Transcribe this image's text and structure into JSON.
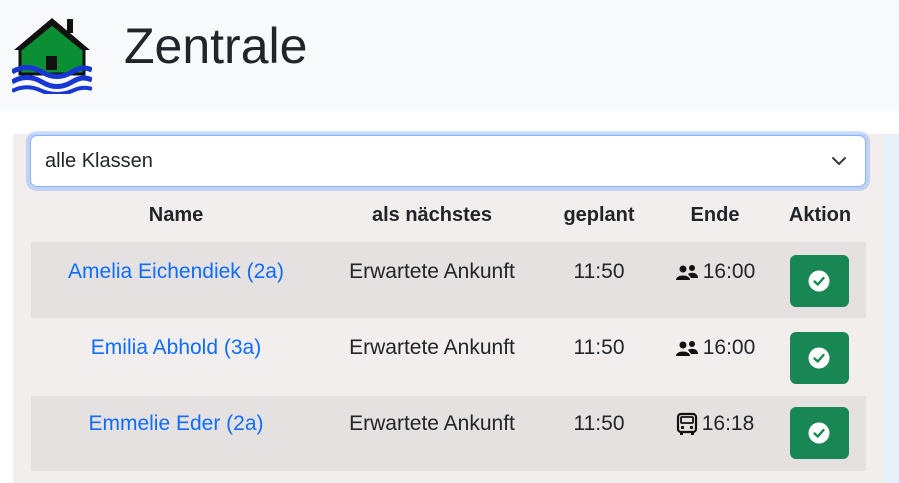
{
  "header": {
    "title": "Zentrale",
    "logo_icon": "house-flood-icon"
  },
  "filter": {
    "selected": "alle Klassen",
    "icon": "chevron-down-icon"
  },
  "table": {
    "columns": [
      "Name",
      "als nächstes",
      "geplant",
      "Ende",
      "Aktion"
    ],
    "rows": [
      {
        "name": "Amelia Eichendiek (2a)",
        "next": "Erwartete Ankunft",
        "planned": "11:50",
        "end_icon": "people-icon",
        "end": "16:00",
        "action_icon": "check-circle-icon"
      },
      {
        "name": "Emilia Abhold (3a)",
        "next": "Erwartete Ankunft",
        "planned": "11:50",
        "end_icon": "people-icon",
        "end": "16:00",
        "action_icon": "check-circle-icon"
      },
      {
        "name": "Emmelie Eder (2a)",
        "next": "Erwartete Ankunft",
        "planned": "11:50",
        "end_icon": "bus-icon",
        "end": "16:18",
        "action_icon": "check-circle-icon"
      }
    ]
  },
  "colors": {
    "header_bg": "#f8f9fa",
    "link": "#0d6efd",
    "action_button": "#198754",
    "logo_house": "#0b8f35",
    "logo_water": "#1737d4"
  }
}
